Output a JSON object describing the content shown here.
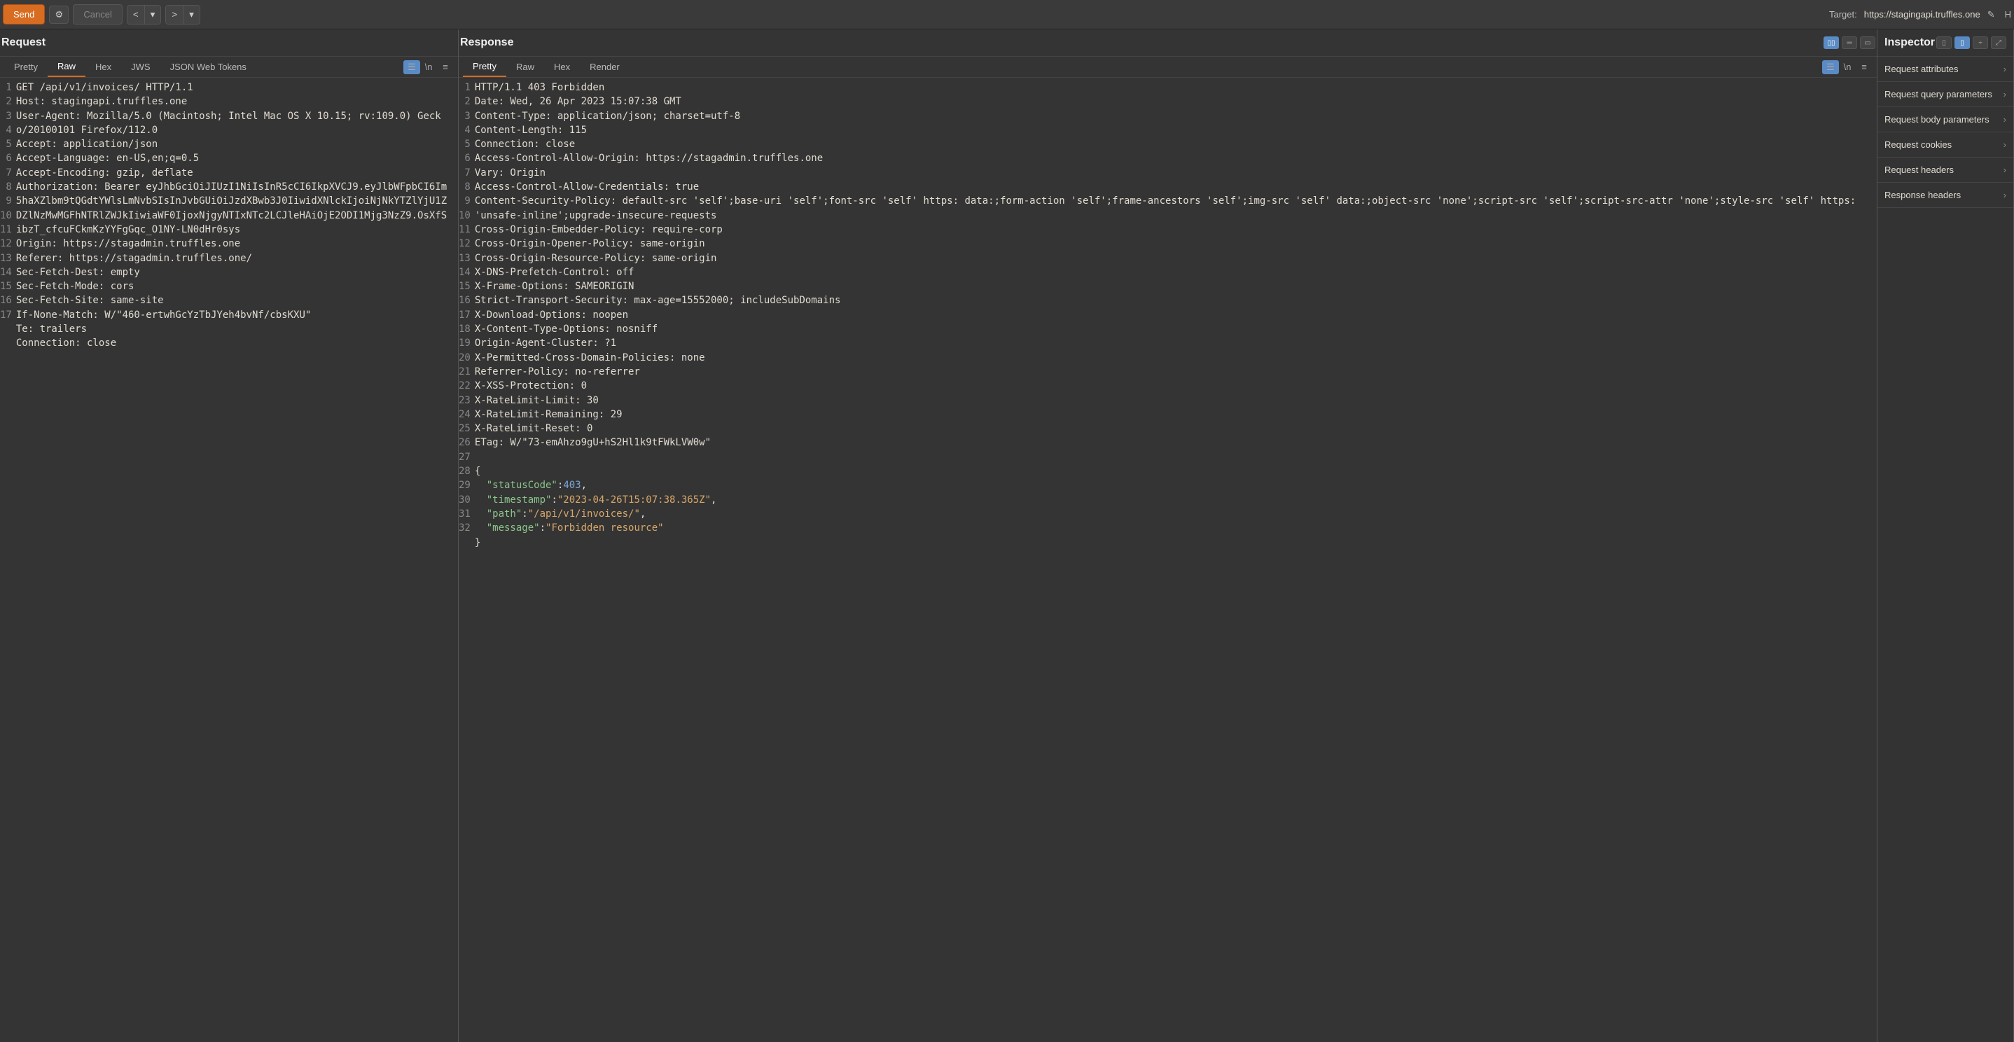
{
  "toolbar": {
    "send_label": "Send",
    "cancel_label": "Cancel",
    "target_prefix": "Target:",
    "target_url": "https://stagingapi.truffles.one",
    "help_initial": "H"
  },
  "request": {
    "title": "Request",
    "tabs": [
      "Pretty",
      "Raw",
      "Hex",
      "JWS",
      "JSON Web Tokens"
    ],
    "active_tab": 1,
    "newline_label": "\\n",
    "lines": [
      "GET /api/v1/invoices/ HTTP/1.1",
      "Host: stagingapi.truffles.one",
      "User-Agent: Mozilla/5.0 (Macintosh; Intel Mac OS X 10.15; rv:109.0) Gecko/20100101 Firefox/112.0",
      "Accept: application/json",
      "Accept-Language: en-US,en;q=0.5",
      "Accept-Encoding: gzip, deflate",
      "Authorization: Bearer eyJhbGciOiJIUzI1NiIsInR5cCI6IkpXVCJ9.eyJlbWFpbCI6Im5haXZlbm9tQGdtYWlsLmNvbSIsInJvbGUiOiJzdXBwb3J0IiwidXNlckIjoiNjNkYTZlYjU1ZDZlNzMwMGFhNTRlZWJkIiwiaWF0IjoxNjgyNTIxNTc2LCJleHAiOjE2ODI1Mjg3NzZ9.OsXfSibzT_cfcuFCkmKzYYFgGqc_O1NY-LN0dHr0sys",
      "Origin: https://stagadmin.truffles.one",
      "Referer: https://stagadmin.truffles.one/",
      "Sec-Fetch-Dest: empty",
      "Sec-Fetch-Mode: cors",
      "Sec-Fetch-Site: same-site",
      "If-None-Match: W/\"460-ertwhGcYzTbJYeh4bvNf/cbsKXU\"",
      "Te: trailers",
      "Connection: close",
      "",
      ""
    ]
  },
  "response": {
    "title": "Response",
    "tabs": [
      "Pretty",
      "Raw",
      "Hex",
      "Render"
    ],
    "active_tab": 0,
    "newline_label": "\\n",
    "lines": [
      "HTTP/1.1 403 Forbidden",
      "Date: Wed, 26 Apr 2023 15:07:38 GMT",
      "Content-Type: application/json; charset=utf-8",
      "Content-Length: 115",
      "Connection: close",
      "Access-Control-Allow-Origin: https://stagadmin.truffles.one",
      "Vary: Origin",
      "Access-Control-Allow-Credentials: true",
      "Content-Security-Policy: default-src 'self';base-uri 'self';font-src 'self' https: data:;form-action 'self';frame-ancestors 'self';img-src 'self' data:;object-src 'none';script-src 'self';script-src-attr 'none';style-src 'self' https: 'unsafe-inline';upgrade-insecure-requests",
      "Cross-Origin-Embedder-Policy: require-corp",
      "Cross-Origin-Opener-Policy: same-origin",
      "Cross-Origin-Resource-Policy: same-origin",
      "X-DNS-Prefetch-Control: off",
      "X-Frame-Options: SAMEORIGIN",
      "Strict-Transport-Security: max-age=15552000; includeSubDomains",
      "X-Download-Options: noopen",
      "X-Content-Type-Options: nosniff",
      "Origin-Agent-Cluster: ?1",
      "X-Permitted-Cross-Domain-Policies: none",
      "Referrer-Policy: no-referrer",
      "X-XSS-Protection: 0",
      "X-RateLimit-Limit: 30",
      "X-RateLimit-Remaining: 29",
      "X-RateLimit-Reset: 0",
      "ETag: W/\"73-emAhzo9gU+hS2Hl1k9tFWkLVW0w\"",
      "",
      "{"
    ],
    "body_json": {
      "statusCode": 403,
      "timestamp": "2023-04-26T15:07:38.365Z",
      "path": "/api/v1/invoices/",
      "message": "Forbidden resource"
    }
  },
  "inspector": {
    "title": "Inspector",
    "sections": [
      "Request attributes",
      "Request query parameters",
      "Request body parameters",
      "Request cookies",
      "Request headers",
      "Response headers"
    ]
  }
}
